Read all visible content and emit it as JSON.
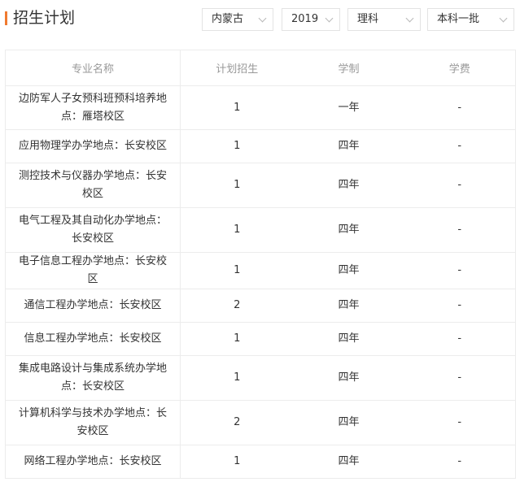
{
  "header": {
    "title": "招生计划",
    "filters": {
      "province": "内蒙古",
      "year": "2019",
      "subject": "理科",
      "batch": "本科一批"
    }
  },
  "table": {
    "columns": [
      "专业名称",
      "计划招生",
      "学制",
      "学费"
    ],
    "rows": [
      {
        "major": "边防军人子女预科班预科培养地点：雁塔校区",
        "plan": "1",
        "duration": "一年",
        "fee": "-"
      },
      {
        "major": "应用物理学办学地点：长安校区",
        "plan": "1",
        "duration": "四年",
        "fee": "-"
      },
      {
        "major": "测控技术与仪器办学地点：长安校区",
        "plan": "1",
        "duration": "四年",
        "fee": "-"
      },
      {
        "major": "电气工程及其自动化办学地点：长安校区",
        "plan": "1",
        "duration": "四年",
        "fee": "-"
      },
      {
        "major": "电子信息工程办学地点：长安校区",
        "plan": "1",
        "duration": "四年",
        "fee": "-"
      },
      {
        "major": "通信工程办学地点：长安校区",
        "plan": "2",
        "duration": "四年",
        "fee": "-"
      },
      {
        "major": "信息工程办学地点：长安校区",
        "plan": "1",
        "duration": "四年",
        "fee": "-"
      },
      {
        "major": "集成电路设计与集成系统办学地点：长安校区",
        "plan": "1",
        "duration": "四年",
        "fee": "-"
      },
      {
        "major": "计算机科学与技术办学地点：长安校区",
        "plan": "2",
        "duration": "四年",
        "fee": "-"
      },
      {
        "major": "网络工程办学地点：长安校区",
        "plan": "1",
        "duration": "四年",
        "fee": "-"
      }
    ]
  }
}
